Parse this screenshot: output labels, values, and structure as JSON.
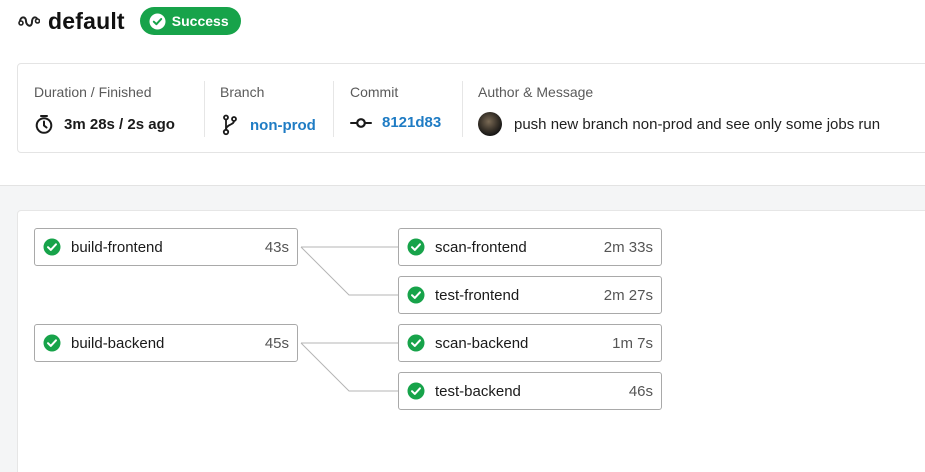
{
  "header": {
    "icon": "pipeline-wave-icon",
    "title": "default",
    "status": "Success",
    "status_color": "#17a34a"
  },
  "info": {
    "duration": {
      "label": "Duration / Finished",
      "value": "3m 28s / 2s ago",
      "icon": "stopwatch-icon"
    },
    "branch": {
      "label": "Branch",
      "value": "non-prod",
      "icon": "branch-icon"
    },
    "commit": {
      "label": "Commit",
      "value": "8121d83",
      "icon": "commit-icon"
    },
    "author": {
      "label": "Author & Message",
      "message": "push new branch non-prod and see only some jobs run",
      "icon": "avatar"
    }
  },
  "jobs": {
    "build_frontend": {
      "name": "build-frontend",
      "duration": "43s"
    },
    "build_backend": {
      "name": "build-backend",
      "duration": "45s"
    },
    "scan_frontend": {
      "name": "scan-frontend",
      "duration": "2m 33s"
    },
    "test_frontend": {
      "name": "test-frontend",
      "duration": "2m 27s"
    },
    "scan_backend": {
      "name": "scan-backend",
      "duration": "1m 7s"
    },
    "test_backend": {
      "name": "test-backend",
      "duration": "46s"
    }
  },
  "colors": {
    "accent_link": "#1f7cc4",
    "success": "#17a34a"
  }
}
